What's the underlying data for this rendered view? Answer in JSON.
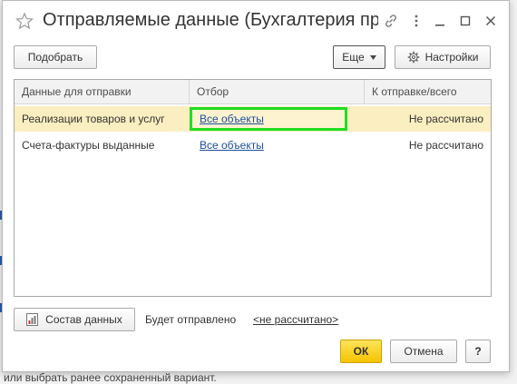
{
  "window": {
    "title": "Отправляемые данные (Бухгалтерия пр..."
  },
  "toolbar": {
    "select_label": "Подобрать",
    "more_label": "Еще",
    "settings_label": "Настройки"
  },
  "table": {
    "columns": [
      "Данные для отправки",
      "Отбор",
      "К отправке/всего"
    ],
    "rows": [
      {
        "data": "Реализации товаров и услуг",
        "filter": "Все объекты",
        "count": "Не рассчитано"
      },
      {
        "data": "Счета-фактуры выданные",
        "filter": "Все объекты",
        "count": "Не рассчитано"
      }
    ]
  },
  "footer": {
    "composition_label": "Состав данных",
    "will_send_label": "Будет отправлено",
    "will_send_value": "<не рассчитано>",
    "ok_label": "ОК",
    "cancel_label": "Отмена",
    "help_label": "?"
  },
  "background": {
    "text": "или выбрать ранее сохраненный вариант."
  },
  "colors": {
    "selected_row": "#fbeec0",
    "focus_border": "#22dd22",
    "link": "#1a4f9c",
    "ok_button": "#f5c400"
  }
}
